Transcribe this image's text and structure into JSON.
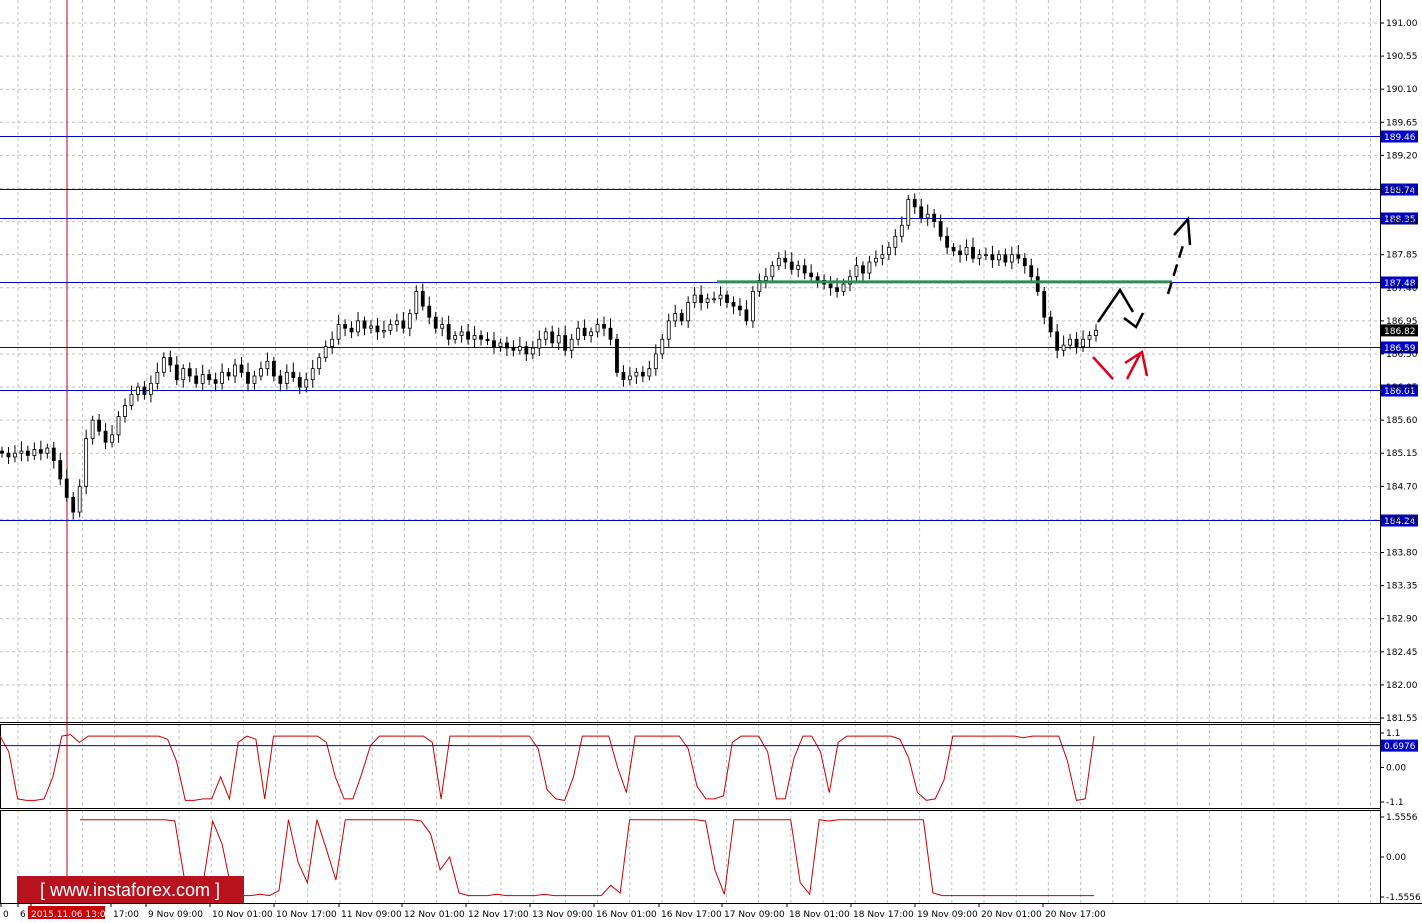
{
  "app": {
    "watermark": "[ www.instaforex.com ]"
  },
  "colors": {
    "background": "#ffffff",
    "grid": "#c0c0c0",
    "level_line": "#0000cc",
    "level_badge": "#0000cc",
    "current_badge": "#000000",
    "marker_line": "#cc0000",
    "indicator": "#cc0000",
    "support_line": "#2e8b57",
    "forecast_black": "#000000",
    "forecast_red": "#e0001a",
    "watermark_bg": "#b8121e"
  },
  "chart_data": [
    {
      "type": "candlestick",
      "title": "",
      "ylim": [
        181.4,
        191.3
      ],
      "y_ticks": [
        "191.00",
        "190.55",
        "190.10",
        "189.65",
        "189.20",
        "188.75",
        "188.30",
        "187.85",
        "187.40",
        "186.95",
        "186.50",
        "186.05",
        "185.60",
        "185.15",
        "184.70",
        "184.25",
        "183.80",
        "183.35",
        "182.90",
        "182.45",
        "182.00",
        "181.55"
      ],
      "x_tick_labels": [
        "0",
        "6",
        "2015.11.06 13:00",
        "17:00",
        "9 Nov 09:00",
        "10 Nov 01:00",
        "10 Nov 17:00",
        "11 Nov 09:00",
        "12 Nov 01:00",
        "12 Nov 17:00",
        "13 Nov 09:00",
        "16 Nov 01:00",
        "16 Nov 17:00",
        "17 Nov 09:00",
        "18 Nov 01:00",
        "18 Nov 17:00",
        "19 Nov 09:00",
        "20 Nov 01:00",
        "20 Nov 17:00"
      ],
      "highlighted_time": "2015.11.06 13:00",
      "levels": [
        "189.46",
        "188.74",
        "188.35",
        "187.48",
        "186.59",
        "186.01",
        "184.24"
      ],
      "current_price": "186.82",
      "support_level": 187.48,
      "series_close": [
        185.15,
        185.1,
        185.15,
        185.18,
        185.12,
        185.2,
        185.15,
        185.22,
        185.05,
        184.8,
        184.55,
        184.35,
        184.7,
        185.35,
        185.6,
        185.45,
        185.3,
        185.4,
        185.65,
        185.8,
        185.95,
        186.05,
        185.95,
        186.1,
        186.25,
        186.45,
        186.35,
        186.15,
        186.3,
        186.2,
        186.1,
        186.22,
        186.15,
        186.1,
        186.25,
        186.2,
        186.35,
        186.25,
        186.1,
        186.2,
        186.3,
        186.4,
        186.2,
        186.1,
        186.25,
        186.18,
        186.05,
        186.15,
        186.3,
        186.45,
        186.6,
        186.7,
        186.9,
        186.85,
        186.8,
        186.95,
        186.85,
        186.88,
        186.8,
        186.82,
        186.9,
        186.95,
        186.85,
        187.05,
        187.35,
        187.15,
        187.0,
        186.85,
        186.9,
        186.7,
        186.75,
        186.8,
        186.7,
        186.75,
        186.7,
        186.68,
        186.6,
        186.65,
        186.58,
        186.55,
        186.6,
        186.5,
        186.58,
        186.7,
        186.8,
        186.65,
        186.75,
        186.55,
        186.7,
        186.85,
        186.75,
        186.8,
        186.9,
        186.85,
        186.7,
        186.25,
        186.15,
        186.2,
        186.25,
        186.2,
        186.3,
        186.5,
        186.7,
        186.95,
        187.05,
        186.95,
        187.2,
        187.3,
        187.2,
        187.25,
        187.25,
        187.3,
        187.2,
        187.15,
        187.1,
        186.95,
        187.35,
        187.5,
        187.55,
        187.7,
        187.8,
        187.75,
        187.65,
        187.7,
        187.6,
        187.55,
        187.5,
        187.45,
        187.4,
        187.35,
        187.45,
        187.55,
        187.7,
        187.6,
        187.75,
        187.8,
        187.85,
        187.95,
        188.1,
        188.25,
        188.6,
        188.5,
        188.35,
        188.4,
        188.3,
        188.1,
        187.95,
        187.9,
        187.85,
        187.95,
        187.8,
        187.85,
        187.85,
        187.78,
        187.85,
        187.75,
        187.85,
        187.8,
        187.7,
        187.55,
        187.35,
        187.0,
        186.8,
        186.55,
        186.62,
        186.7,
        186.6,
        186.7,
        186.75,
        186.82
      ]
    },
    {
      "type": "line",
      "title": "",
      "ylim": [
        -1.1,
        1.1
      ],
      "y_ticks": [
        "1.1",
        "0.00",
        "-1.1"
      ],
      "level_value": "0.6976",
      "values": [
        1.0,
        0.5,
        -1.0,
        -1.05,
        -1.05,
        -1.0,
        -0.3,
        1.0,
        1.05,
        0.8,
        1.0,
        1.0,
        1.0,
        1.0,
        1.0,
        1.0,
        1.0,
        1.0,
        1.0,
        0.9,
        0.2,
        -1.05,
        -1.05,
        -1.0,
        -1.0,
        -0.3,
        -1.0,
        0.8,
        1.0,
        0.9,
        -1.0,
        1.0,
        1.0,
        1.0,
        1.0,
        1.0,
        1.0,
        0.8,
        -0.3,
        -1.0,
        -1.0,
        -0.2,
        0.7,
        1.0,
        1.0,
        1.0,
        1.0,
        1.0,
        1.0,
        0.8,
        -1.0,
        1.0,
        1.0,
        1.0,
        1.0,
        1.0,
        1.0,
        1.0,
        1.0,
        1.0,
        1.0,
        0.6,
        -0.7,
        -1.0,
        -1.05,
        -0.3,
        1.0,
        1.0,
        1.0,
        1.0,
        0.0,
        -0.8,
        1.0,
        1.0,
        1.0,
        1.0,
        1.0,
        1.0,
        0.6,
        -0.6,
        -1.0,
        -1.0,
        -0.9,
        0.8,
        1.0,
        1.0,
        1.0,
        0.5,
        -1.0,
        -1.0,
        0.3,
        1.0,
        1.0,
        0.5,
        -0.8,
        0.8,
        1.0,
        1.0,
        1.0,
        1.0,
        1.0,
        1.0,
        0.9,
        0.3,
        -0.8,
        -1.05,
        -1.0,
        -0.4,
        1.0,
        1.0,
        1.0,
        1.0,
        1.0,
        1.0,
        1.0,
        1.0,
        0.95,
        1.0,
        1.0,
        1.0,
        1.0,
        0.2,
        -1.05,
        -1.0,
        1.0
      ]
    },
    {
      "type": "line",
      "title": "",
      "ylim": [
        -1.5556,
        1.5556
      ],
      "y_ticks": [
        "1.5556",
        "0.00",
        "-1.5556"
      ],
      "values": [
        1.45,
        1.45,
        1.45,
        1.45,
        1.45,
        1.45,
        1.45,
        1.45,
        1.45,
        1.45,
        1.4,
        -0.8,
        -1.5,
        -1.0,
        1.4,
        0.5,
        -1.3,
        -1.5,
        -1.5,
        -1.45,
        -1.5,
        -1.3,
        1.45,
        -0.2,
        -1.0,
        1.45,
        0.3,
        -0.9,
        1.45,
        1.45,
        1.45,
        1.45,
        1.45,
        1.45,
        1.45,
        1.45,
        1.4,
        0.9,
        -0.5,
        0.0,
        -1.4,
        -1.5,
        -1.5,
        -1.5,
        -1.45,
        -1.5,
        -1.5,
        -1.5,
        -1.5,
        -1.45,
        -1.5,
        -1.5,
        -1.5,
        -1.5,
        -1.5,
        -1.5,
        -1.1,
        -1.4,
        1.45,
        1.45,
        1.45,
        1.45,
        1.45,
        1.45,
        1.45,
        1.45,
        1.4,
        -0.5,
        -1.45,
        1.45,
        1.45,
        1.45,
        1.45,
        1.45,
        1.45,
        1.45,
        -1.0,
        -1.45,
        1.45,
        1.4,
        1.45,
        1.45,
        1.45,
        1.45,
        1.45,
        1.45,
        1.45,
        1.45,
        1.45,
        1.45,
        -1.4,
        -1.5,
        -1.5,
        -1.5,
        -1.5,
        -1.5,
        -1.5,
        -1.5,
        -1.5,
        -1.5,
        -1.5,
        -1.5,
        -1.5,
        -1.5,
        -1.5,
        -1.5,
        -1.5,
        -1.5
      ]
    }
  ]
}
